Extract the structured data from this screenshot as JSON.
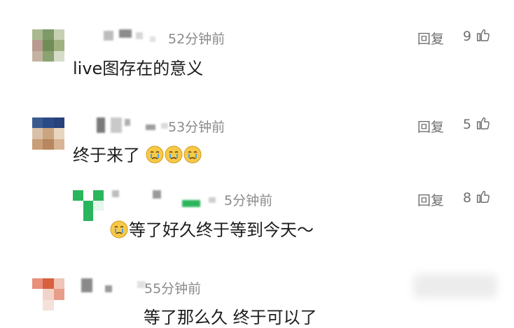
{
  "comments": [
    {
      "time": "52分钟前",
      "reply_label": "回复",
      "likes": "9",
      "text": "live图存在的意义",
      "avatar_icon": "pixelated-avatar"
    },
    {
      "time": "53分钟前",
      "reply_label": "回复",
      "likes": "5",
      "text": "终于来了",
      "emoji_icon": "crying-face-emoji",
      "emoji_count": 3
    },
    {
      "time": "5分钟前",
      "reply_label": "回复",
      "likes": "8",
      "text": "等了好久终于等到今天～",
      "emoji_icon": "crying-face-emoji",
      "is_reply": true
    },
    {
      "time": "55分钟前",
      "text": "等了那么久 终于可以了"
    }
  ],
  "colors": {
    "text": "#1c1c1c",
    "meta": "#8a8a8a",
    "accent_green": "#2ab55c"
  }
}
